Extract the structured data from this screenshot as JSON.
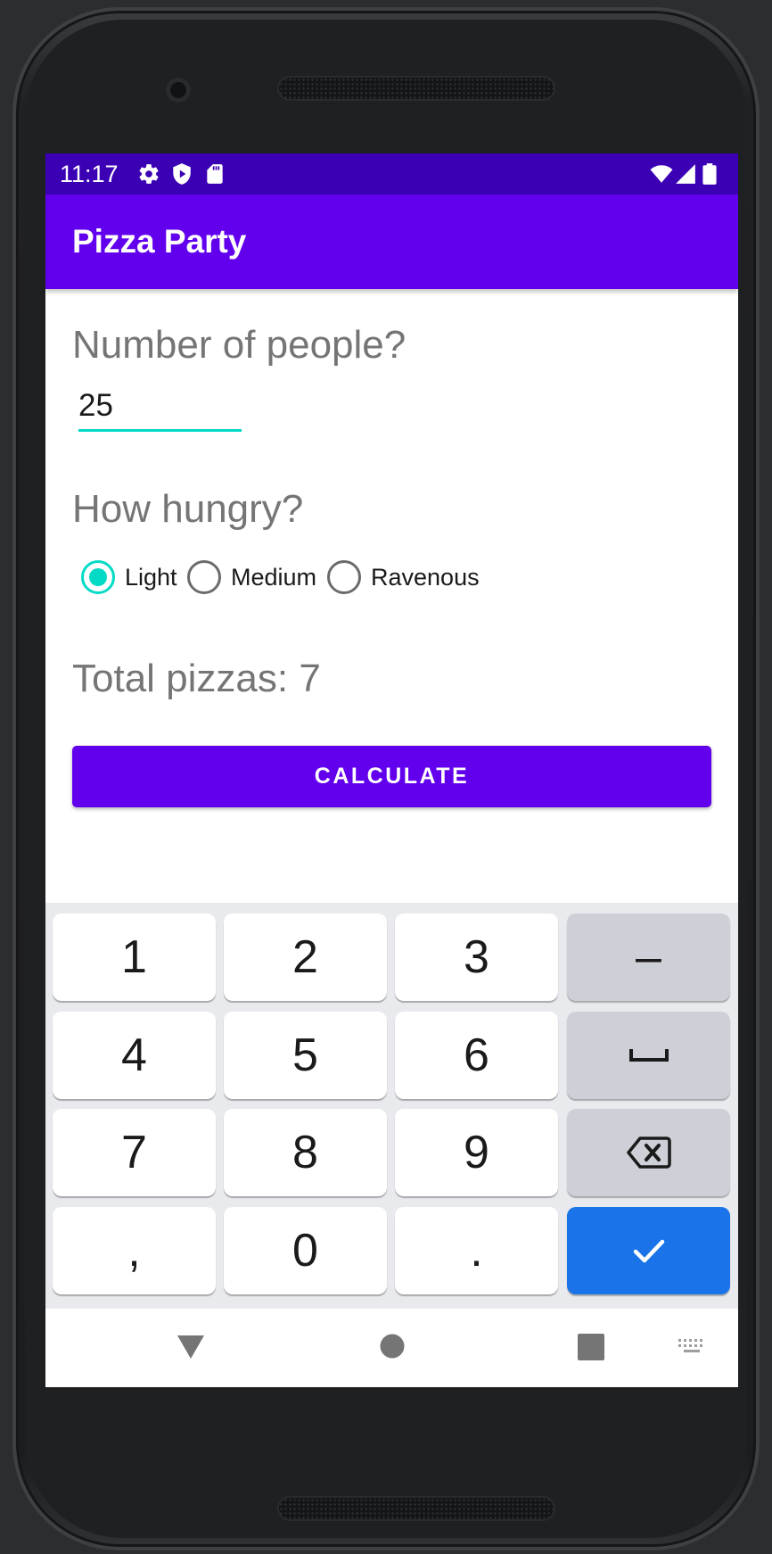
{
  "status_bar": {
    "time": "11:17",
    "left_icons": [
      "gear-icon",
      "shield-icon",
      "sd-card-icon"
    ],
    "right_icons": [
      "wifi-icon",
      "signal-icon",
      "battery-icon"
    ],
    "background": "#3b00b3"
  },
  "app_bar": {
    "title": "Pizza Party",
    "background": "#6200ee"
  },
  "form": {
    "people_label": "Number of people?",
    "people_value": "25",
    "hunger_label": "How hungry?",
    "hunger_options": [
      {
        "label": "Light",
        "checked": true
      },
      {
        "label": "Medium",
        "checked": false
      },
      {
        "label": "Ravenous",
        "checked": false
      }
    ],
    "total_text": "Total pizzas: 7",
    "calculate_label": "CALCULATE"
  },
  "keyboard": {
    "keys": [
      "1",
      "2",
      "3",
      "–",
      "4",
      "5",
      "6",
      "space-icon",
      "7",
      "8",
      "9",
      "backspace-icon",
      ",",
      "0",
      ".",
      "check-icon"
    ],
    "digit_keys": {
      "k1": "1",
      "k2": "2",
      "k3": "3",
      "k4": "4",
      "k5": "5",
      "k6": "6",
      "k7": "7",
      "k8": "8",
      "k9": "9",
      "k0": "0"
    },
    "symbol_keys": {
      "minus": "–",
      "comma": ",",
      "period": "."
    },
    "enter_color": "#1a73e8"
  },
  "nav_bar": {
    "buttons": [
      "back-icon",
      "home-icon",
      "recents-icon",
      "keyboard-switch-icon"
    ]
  },
  "colors": {
    "accent": "#03dac5",
    "primary": "#6200ee",
    "primary_dark": "#3b00b3"
  }
}
